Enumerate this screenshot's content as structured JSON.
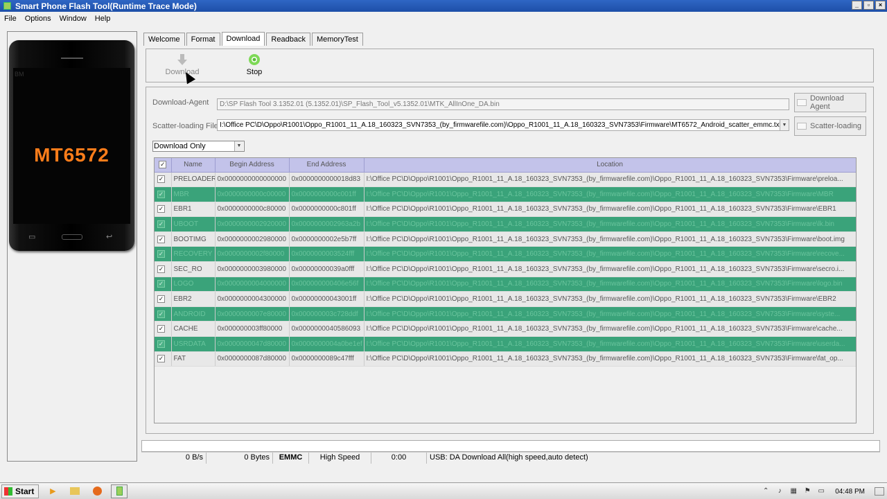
{
  "window": {
    "title": "Smart Phone Flash Tool(Runtime Trace Mode)"
  },
  "menu": [
    "File",
    "Options",
    "Window",
    "Help"
  ],
  "phone": {
    "brand": "BM",
    "chip": "MT6572"
  },
  "tabs": [
    "Welcome",
    "Format",
    "Download",
    "Readback",
    "MemoryTest"
  ],
  "toolbar": {
    "download_label": "Download",
    "stop_label": "Stop"
  },
  "form": {
    "download_agent_label": "Download-Agent",
    "download_agent_value": "D:\\SP Flash Tool 3.1352.01 (5.1352.01)\\SP_Flash_Tool_v5.1352.01\\MTK_AllInOne_DA.bin",
    "download_agent_button": "Download Agent",
    "scatter_label": "Scatter-loading File",
    "scatter_value": "I:\\Office PC\\D\\Oppo\\R1001\\Oppo_R1001_11_A.18_160323_SVN7353_(by_firmwarefile.com)\\Oppo_R1001_11_A.18_160323_SVN7353\\Firmware\\MT6572_Android_scatter_emmc.txt",
    "scatter_button": "Scatter-loading",
    "mode_value": "Download Only"
  },
  "table": {
    "columns": [
      "Name",
      "Begin Address",
      "End Address",
      "Location"
    ],
    "rows": [
      {
        "name": "PRELOADER",
        "begin": "0x0000000000000000",
        "end": "0x0000000000018d83",
        "location": "I:\\Office PC\\D\\Oppo\\R1001\\Oppo_R1001_11_A.18_160323_SVN7353_(by_firmwarefile.com)\\Oppo_R1001_11_A.18_160323_SVN7353\\Firmware\\preloa..."
      },
      {
        "name": "MBR",
        "begin": "0x0000000000c00000",
        "end": "0x0000000000c001ff",
        "location": "I:\\Office PC\\D\\Oppo\\R1001\\Oppo_R1001_11_A.18_160323_SVN7353_(by_firmwarefile.com)\\Oppo_R1001_11_A.18_160323_SVN7353\\Firmware\\MBR"
      },
      {
        "name": "EBR1",
        "begin": "0x0000000000c80000",
        "end": "0x0000000000c801ff",
        "location": "I:\\Office PC\\D\\Oppo\\R1001\\Oppo_R1001_11_A.18_160323_SVN7353_(by_firmwarefile.com)\\Oppo_R1001_11_A.18_160323_SVN7353\\Firmware\\EBR1"
      },
      {
        "name": "UBOOT",
        "begin": "0x0000000002920000",
        "end": "0x0000000002963a2b",
        "location": "I:\\Office PC\\D\\Oppo\\R1001\\Oppo_R1001_11_A.18_160323_SVN7353_(by_firmwarefile.com)\\Oppo_R1001_11_A.18_160323_SVN7353\\Firmware\\lk.bin"
      },
      {
        "name": "BOOTIMG",
        "begin": "0x0000000002980000",
        "end": "0x0000000002e5b7ff",
        "location": "I:\\Office PC\\D\\Oppo\\R1001\\Oppo_R1001_11_A.18_160323_SVN7353_(by_firmwarefile.com)\\Oppo_R1001_11_A.18_160323_SVN7353\\Firmware\\boot.img"
      },
      {
        "name": "RECOVERY",
        "begin": "0x0000000002f80000",
        "end": "0x0000000003524fff",
        "location": "I:\\Office PC\\D\\Oppo\\R1001\\Oppo_R1001_11_A.18_160323_SVN7353_(by_firmwarefile.com)\\Oppo_R1001_11_A.18_160323_SVN7353\\Firmware\\recove..."
      },
      {
        "name": "SEC_RO",
        "begin": "0x0000000003980000",
        "end": "0x00000000039a0fff",
        "location": "I:\\Office PC\\D\\Oppo\\R1001\\Oppo_R1001_11_A.18_160323_SVN7353_(by_firmwarefile.com)\\Oppo_R1001_11_A.18_160323_SVN7353\\Firmware\\secro.i..."
      },
      {
        "name": "LOGO",
        "begin": "0x0000000004000000",
        "end": "0x000000000406e56f",
        "location": "I:\\Office PC\\D\\Oppo\\R1001\\Oppo_R1001_11_A.18_160323_SVN7353_(by_firmwarefile.com)\\Oppo_R1001_11_A.18_160323_SVN7353\\Firmware\\logo.bin"
      },
      {
        "name": "EBR2",
        "begin": "0x0000000004300000",
        "end": "0x00000000043001ff",
        "location": "I:\\Office PC\\D\\Oppo\\R1001\\Oppo_R1001_11_A.18_160323_SVN7353_(by_firmwarefile.com)\\Oppo_R1001_11_A.18_160323_SVN7353\\Firmware\\EBR2"
      },
      {
        "name": "ANDROID",
        "begin": "0x0000000007e80000",
        "end": "0x000000003c728ddf",
        "location": "I:\\Office PC\\D\\Oppo\\R1001\\Oppo_R1001_11_A.18_160323_SVN7353_(by_firmwarefile.com)\\Oppo_R1001_11_A.18_160323_SVN7353\\Firmware\\syste..."
      },
      {
        "name": "CACHE",
        "begin": "0x000000003ff80000",
        "end": "0x0000000040586093",
        "location": "I:\\Office PC\\D\\Oppo\\R1001\\Oppo_R1001_11_A.18_160323_SVN7353_(by_firmwarefile.com)\\Oppo_R1001_11_A.18_160323_SVN7353\\Firmware\\cache..."
      },
      {
        "name": "USRDATA",
        "begin": "0x0000000047d80000",
        "end": "0x0000000004a0be1ef",
        "location": "I:\\Office PC\\D\\Oppo\\R1001\\Oppo_R1001_11_A.18_160323_SVN7353_(by_firmwarefile.com)\\Oppo_R1001_11_A.18_160323_SVN7353\\Firmware\\userda..."
      },
      {
        "name": "FAT",
        "begin": "0x0000000087d80000",
        "end": "0x0000000089c47fff",
        "location": "I:\\Office PC\\D\\Oppo\\R1001\\Oppo_R1001_11_A.18_160323_SVN7353_(by_firmwarefile.com)\\Oppo_R1001_11_A.18_160323_SVN7353\\Firmware\\fat_op..."
      }
    ]
  },
  "status": {
    "speed": "0 B/s",
    "bytes": "0 Bytes",
    "storage": "EMMC",
    "mode": "High Speed",
    "time": "0:00",
    "message": "USB: DA Download All(high speed,auto detect)"
  },
  "taskbar": {
    "start_label": "Start",
    "clock": "04:48 PM"
  },
  "colors": {
    "header": "#c3c3ea",
    "odd_row": "#3aa37a",
    "title_bar": "#2f66c4",
    "chip_text": "#ff7d1a"
  }
}
